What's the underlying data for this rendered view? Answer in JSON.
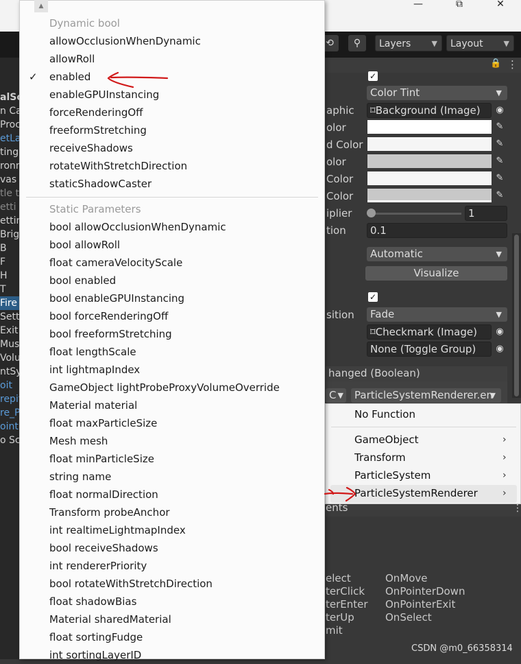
{
  "window": {
    "minimize": "—",
    "maximize": "⧉",
    "close": "✕"
  },
  "toolbar": {
    "history_icon": "⟲",
    "search_icon": "⚲",
    "layers_label": "Layers",
    "layout_label": "Layout"
  },
  "hierarchy": {
    "rows": [
      {
        "text": "alSc",
        "cls": "bold"
      },
      {
        "text": "n Ca",
        "cls": ""
      },
      {
        "text": "Proc",
        "cls": ""
      },
      {
        "text": "etLa",
        "cls": "blue"
      },
      {
        "text": "ting",
        "cls": ""
      },
      {
        "text": "ronm",
        "cls": ""
      },
      {
        "text": "vas",
        "cls": ""
      },
      {
        "text": "tle t",
        "cls": "dim"
      },
      {
        "text": "etti",
        "cls": "dim"
      },
      {
        "text": "etting",
        "cls": ""
      },
      {
        "text": "Brig",
        "cls": ""
      },
      {
        "text": "B",
        "cls": ""
      },
      {
        "text": "F",
        "cls": ""
      },
      {
        "text": "H",
        "cls": ""
      },
      {
        "text": "T",
        "cls": ""
      },
      {
        "text": "Fire",
        "cls": "sel"
      },
      {
        "text": "Sett",
        "cls": ""
      },
      {
        "text": "Exit",
        "cls": ""
      },
      {
        "text": "Mus",
        "cls": ""
      },
      {
        "text": "Volu",
        "cls": ""
      },
      {
        "text": "ntSy",
        "cls": ""
      },
      {
        "text": "oit",
        "cls": "blue"
      },
      {
        "text": "repit",
        "cls": "blue"
      },
      {
        "text": "re_P",
        "cls": "blue"
      },
      {
        "text": "oint",
        "cls": "blue"
      },
      {
        "text": "o Sc",
        "cls": ""
      }
    ]
  },
  "inspector": {
    "lock_icon": "🔒",
    "more_icon": "⋮",
    "transition_value": "Color Tint",
    "target_graphic_label": "aphic",
    "target_graphic_value": "Background (Image)",
    "normal_color_label": "olor",
    "highlighted_color_label": "d Color",
    "pressed_color_label": "olor",
    "selected_color_label": "Color",
    "disabled_color_label": "Color",
    "multiplier_label": "iplier",
    "multiplier_value": "1",
    "fade_duration_label": "tion",
    "fade_duration_value": "0.1",
    "navigation_value": "Automatic",
    "visualize_label": "Visualize",
    "toggle_transition_label": "sition",
    "toggle_transition_value": "Fade",
    "graphic_value": "Checkmark (Image)",
    "group_value": "None (Toggle Group)",
    "event_header": "hanged (Boolean)",
    "runtime_value": "C",
    "function_value": "ParticleSystemRenderer.en",
    "events_header": "ents",
    "event_types_col1": [
      "elect",
      "terClick",
      "terEnter",
      "terUp",
      "mit"
    ],
    "event_types_col2": [
      "OnMove",
      "OnPointerDown",
      "OnPointerExit",
      "OnSelect"
    ]
  },
  "menu": {
    "dynamic_header": "Dynamic bool",
    "dynamic_items": [
      "allowOcclusionWhenDynamic",
      "allowRoll",
      "enabled",
      "enableGPUInstancing",
      "forceRenderingOff",
      "freeformStretching",
      "receiveShadows",
      "rotateWithStretchDirection",
      "staticShadowCaster"
    ],
    "checked_item": "enabled",
    "check_mark": "✓",
    "static_header": "Static Parameters",
    "static_items": [
      "bool allowOcclusionWhenDynamic",
      "bool allowRoll",
      "float cameraVelocityScale",
      "bool enabled",
      "bool enableGPUInstancing",
      "bool forceRenderingOff",
      "bool freeformStretching",
      "float lengthScale",
      "int lightmapIndex",
      "GameObject lightProbeProxyVolumeOverride",
      "Material material",
      "float maxParticleSize",
      "Mesh mesh",
      "float minParticleSize",
      "string name",
      "float normalDirection",
      "Transform probeAnchor",
      "int realtimeLightmapIndex",
      "bool receiveShadows",
      "int rendererPriority",
      "bool rotateWithStretchDirection",
      "float shadowBias",
      "Material sharedMaterial",
      "float sortingFudge",
      "int sortingLayerID"
    ]
  },
  "context_menu": {
    "no_function": "No Function",
    "items": [
      "GameObject",
      "Transform",
      "ParticleSystem",
      "ParticleSystemRenderer"
    ],
    "arrow": "›"
  },
  "annotation_color": "#d11a1a",
  "watermark": "CSDN @m0_66358314"
}
